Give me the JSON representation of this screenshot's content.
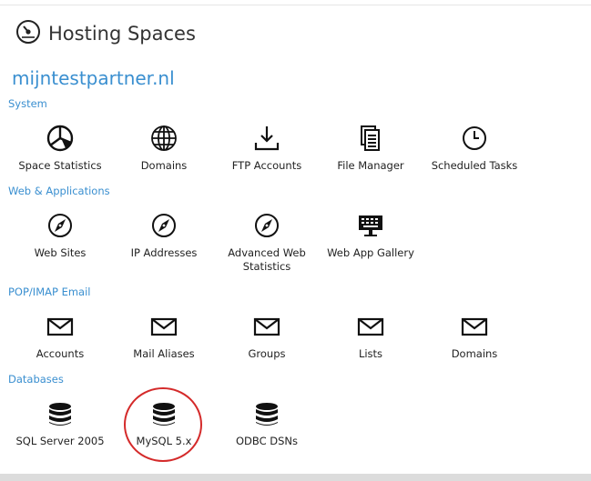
{
  "header": {
    "title": "Hosting Spaces",
    "icon": "dashboard-gauge-icon"
  },
  "space_name": "mijntestpartner.nl",
  "sections": {
    "system": {
      "title": "System",
      "items": [
        {
          "label": "Space Statistics",
          "icon": "pie-chart-icon"
        },
        {
          "label": "Domains",
          "icon": "globe-icon"
        },
        {
          "label": "FTP Accounts",
          "icon": "download-tray-icon"
        },
        {
          "label": "File Manager",
          "icon": "document-stack-icon"
        },
        {
          "label": "Scheduled Tasks",
          "icon": "clock-icon"
        }
      ]
    },
    "web": {
      "title": "Web & Applications",
      "items": [
        {
          "label": "Web Sites",
          "icon": "compass-icon"
        },
        {
          "label": "IP Addresses",
          "icon": "compass-icon"
        },
        {
          "label": "Advanced Web Statistics",
          "icon": "compass-icon"
        },
        {
          "label": "Web App Gallery",
          "icon": "keyboard-monitor-icon"
        }
      ]
    },
    "email": {
      "title": "POP/IMAP Email",
      "items": [
        {
          "label": "Accounts",
          "icon": "envelope-icon"
        },
        {
          "label": "Mail Aliases",
          "icon": "envelope-icon"
        },
        {
          "label": "Groups",
          "icon": "envelope-icon"
        },
        {
          "label": "Lists",
          "icon": "envelope-icon"
        },
        {
          "label": "Domains",
          "icon": "envelope-icon"
        }
      ]
    },
    "databases": {
      "title": "Databases",
      "items": [
        {
          "label": "SQL Server 2005",
          "icon": "database-icon"
        },
        {
          "label": "MySQL 5.x",
          "icon": "database-icon"
        },
        {
          "label": "ODBC DSNs",
          "icon": "database-icon"
        }
      ]
    }
  },
  "annotation": {
    "highlighted_item": "MySQL 5.x",
    "color": "#d42a2a"
  },
  "colors": {
    "link": "#3a8fd0",
    "text": "#222222"
  }
}
